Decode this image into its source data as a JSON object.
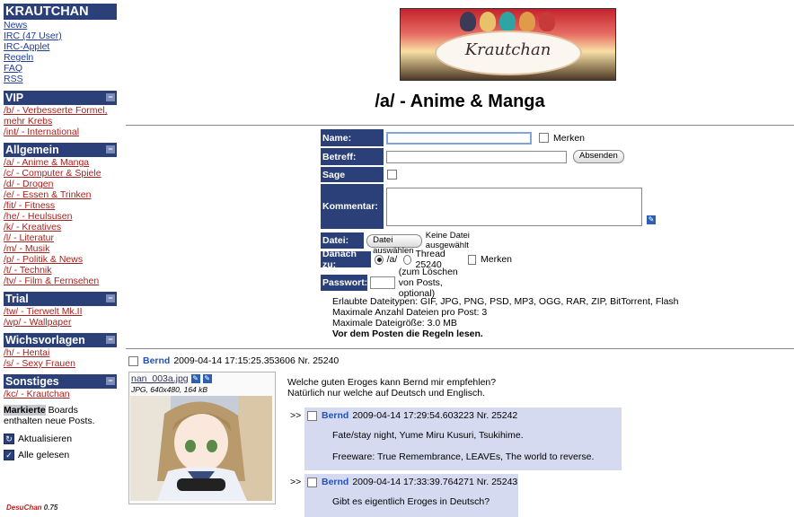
{
  "sidebar": {
    "site_title": "KRAUTCHAN",
    "main_links": [
      "News",
      "IRC (47 User)",
      "IRC-Applet",
      "Regeln",
      "FAQ",
      "RSS"
    ],
    "sections": [
      {
        "title": "VIP",
        "items": [
          "/b/ - Verbesserte Formel,",
          "mehr Krebs",
          "/int/ - International"
        ]
      },
      {
        "title": "Allgemein",
        "items": [
          "/a/ - Anime & Manga",
          "/c/ - Computer & Spiele",
          "/d/ - Drogen",
          "/e/ - Essen & Trinken",
          "/fit/ - Fitness",
          "/he/ - Heulsusen",
          "/k/ - Kreatives",
          "/l/ - Literatur",
          "/m/ - Musik",
          "/p/ - Politik & News",
          "/t/ - Technik",
          "/tv/ - Film & Fernsehen"
        ]
      },
      {
        "title": "Trial",
        "items": [
          "/tw/ - Tierwelt Mk.II",
          "/wp/ - Wallpaper"
        ]
      },
      {
        "title": "Wichsvorlagen",
        "items": [
          "/h/ - Hentai",
          "/s/ - Sexy Frauen"
        ]
      },
      {
        "title": "Sonstiges",
        "items": [
          "/kc/ - Krautchan"
        ]
      }
    ],
    "toggle_symbol": "−",
    "note_highlight": "Markierte",
    "note_rest_1": " Boards",
    "note_rest_2": "enthalten neue Posts.",
    "refresh_label": "Aktualisieren",
    "read_all_label": "Alle gelesen",
    "brand_name": "DesuChan",
    "brand_version": "0.75"
  },
  "banner": {
    "text": "Krautchan"
  },
  "board_title": "/a/ - Anime & Manga",
  "form": {
    "name_label": "Name:",
    "subject_label": "Betreff:",
    "sage_label": "Sage",
    "comment_label": "Kommentar:",
    "file_label": "Datei:",
    "goto_label": "Danach zu:",
    "password_label": "Passwort:",
    "remember_label": "Merken",
    "submit_label": "Absenden",
    "file_button": "Datei auswählen",
    "file_status": "Keine Datei ausgewählt",
    "goto_board": "/a/",
    "goto_thread": "Thread 25240",
    "goto_remember": "Merken",
    "password_hint": "(zum Löschen von Posts, optional)"
  },
  "rules": [
    "Erlaubte Dateitypen: GIF, JPG, PNG, PSD, MP3, OGG, RAR, ZIP, BitTorrent, Flash",
    "Maximale Anzahl Dateien pro Post: 3",
    "Maximale Dateigröße: 3.0 MB",
    "Vor dem Posten die Regeln lesen."
  ],
  "op": {
    "name": "Bernd",
    "date": "2009-04-14 17:15:25.353606",
    "number": "Nr. 25240",
    "file_name": "nan_003a.jpg",
    "file_meta": "JPG, 640x480, 164 kB",
    "text": [
      "Welche guten Eroges kann Bernd mir empfehlen?",
      "Natürlich nur welche auf Deutsch und Englisch."
    ]
  },
  "replies": [
    {
      "arrow": ">>",
      "name": "Bernd",
      "date": "2009-04-14 17:29:54.603223",
      "number": "Nr. 25242",
      "text": [
        "Fate/stay night, Yume Miru Kusuri, Tsukihime.",
        "Freeware: True Remembrance, LEAVEs, The world to reverse."
      ]
    },
    {
      "arrow": ">>",
      "name": "Bernd",
      "date": "2009-04-14 17:33:39.764271",
      "number": "Nr. 25243",
      "text": [
        "Gibt es eigentlich Eroges in Deutsch?"
      ]
    }
  ],
  "colors": {
    "header_bg": "#2b3f78",
    "reply_bg": "#d6daf0",
    "name": "#2452b8",
    "link_red": "#a8211e"
  }
}
